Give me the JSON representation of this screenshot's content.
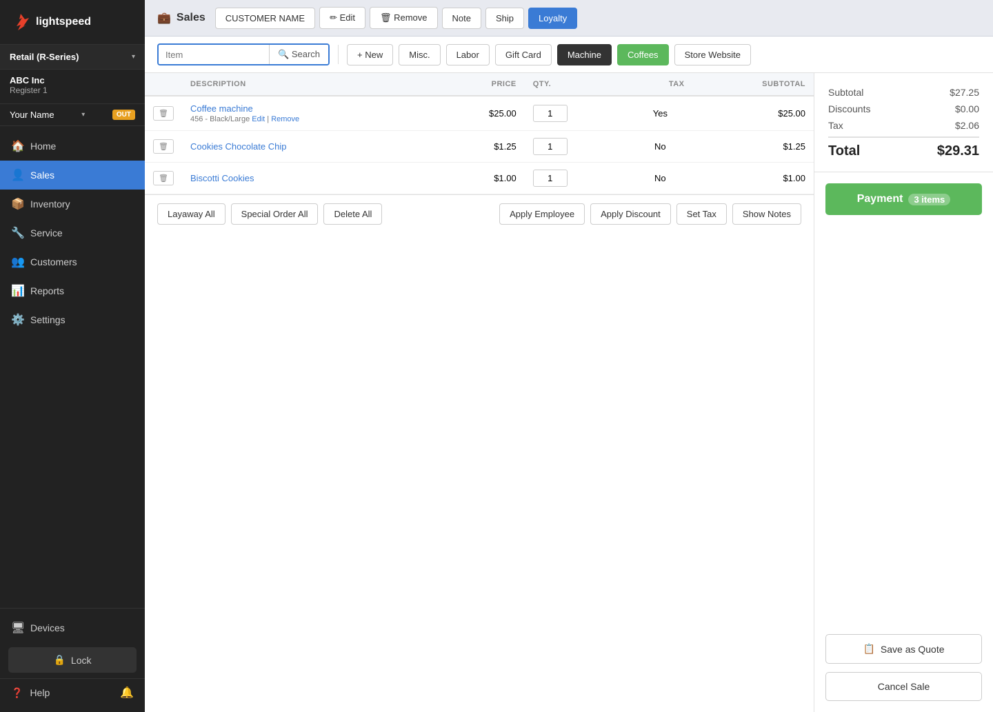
{
  "app": {
    "logo_text": "lightspeed",
    "page_title": "Sales",
    "page_icon": "💼"
  },
  "store": {
    "type": "Retail (R-Series)",
    "company": "ABC Inc",
    "register": "Register 1",
    "user": "Your Name",
    "user_arrow": "▾",
    "out_label": "OUT"
  },
  "nav": {
    "items": [
      {
        "id": "home",
        "label": "Home",
        "icon": "🏠",
        "active": false
      },
      {
        "id": "sales",
        "label": "Sales",
        "icon": "👤",
        "active": true
      },
      {
        "id": "inventory",
        "label": "Inventory",
        "icon": "📦",
        "active": false
      },
      {
        "id": "service",
        "label": "Service",
        "icon": "🔧",
        "active": false
      },
      {
        "id": "customers",
        "label": "Customers",
        "icon": "👥",
        "active": false
      },
      {
        "id": "reports",
        "label": "Reports",
        "icon": "📊",
        "active": false
      },
      {
        "id": "settings",
        "label": "Settings",
        "icon": "⚙️",
        "active": false
      }
    ]
  },
  "sidebar_bottom": {
    "devices_label": "Devices",
    "lock_label": "Lock",
    "help_label": "Help"
  },
  "customer_bar": {
    "customer_name_label": "CUSTOMER NAME",
    "edit_label": "✏ Edit",
    "remove_label": "🗑 Remove",
    "note_label": "Note",
    "ship_label": "Ship",
    "loyalty_label": "Loyalty"
  },
  "toolbar": {
    "item_placeholder": "Item",
    "search_label": "Search",
    "new_label": "+ New",
    "misc_label": "Misc.",
    "labor_label": "Labor",
    "gift_card_label": "Gift Card",
    "machine_label": "Machine",
    "coffees_label": "Coffees",
    "store_website_label": "Store Website"
  },
  "table": {
    "headers": [
      "",
      "DESCRIPTION",
      "PRICE",
      "QTY.",
      "TAX",
      "SUBTOTAL"
    ],
    "rows": [
      {
        "id": 1,
        "name": "Coffee machine",
        "desc": "456 - Black/Large",
        "price": "$25.00",
        "qty": "1",
        "tax": "Yes",
        "subtotal": "$25.00",
        "has_edit": true
      },
      {
        "id": 2,
        "name": "Cookies Chocolate Chip",
        "desc": "",
        "price": "$1.25",
        "qty": "1",
        "tax": "No",
        "subtotal": "$1.25",
        "has_edit": false
      },
      {
        "id": 3,
        "name": "Biscotti Cookies",
        "desc": "",
        "price": "$1.00",
        "qty": "1",
        "tax": "No",
        "subtotal": "$1.00",
        "has_edit": false
      }
    ]
  },
  "action_bar": {
    "layaway_all": "Layaway All",
    "special_order_all": "Special Order All",
    "delete_all": "Delete All",
    "apply_employee": "Apply Employee",
    "apply_discount": "Apply Discount",
    "set_tax": "Set Tax",
    "show_notes": "Show Notes"
  },
  "summary": {
    "subtotal_label": "Subtotal",
    "subtotal_value": "$27.25",
    "discounts_label": "Discounts",
    "discounts_value": "$0.00",
    "tax_label": "Tax",
    "tax_value": "$2.06",
    "total_label": "Total",
    "total_value": "$29.31"
  },
  "right_panel": {
    "payment_label": "Payment",
    "items_count": "3 items",
    "save_quote_label": "Save as Quote",
    "cancel_sale_label": "Cancel Sale"
  }
}
